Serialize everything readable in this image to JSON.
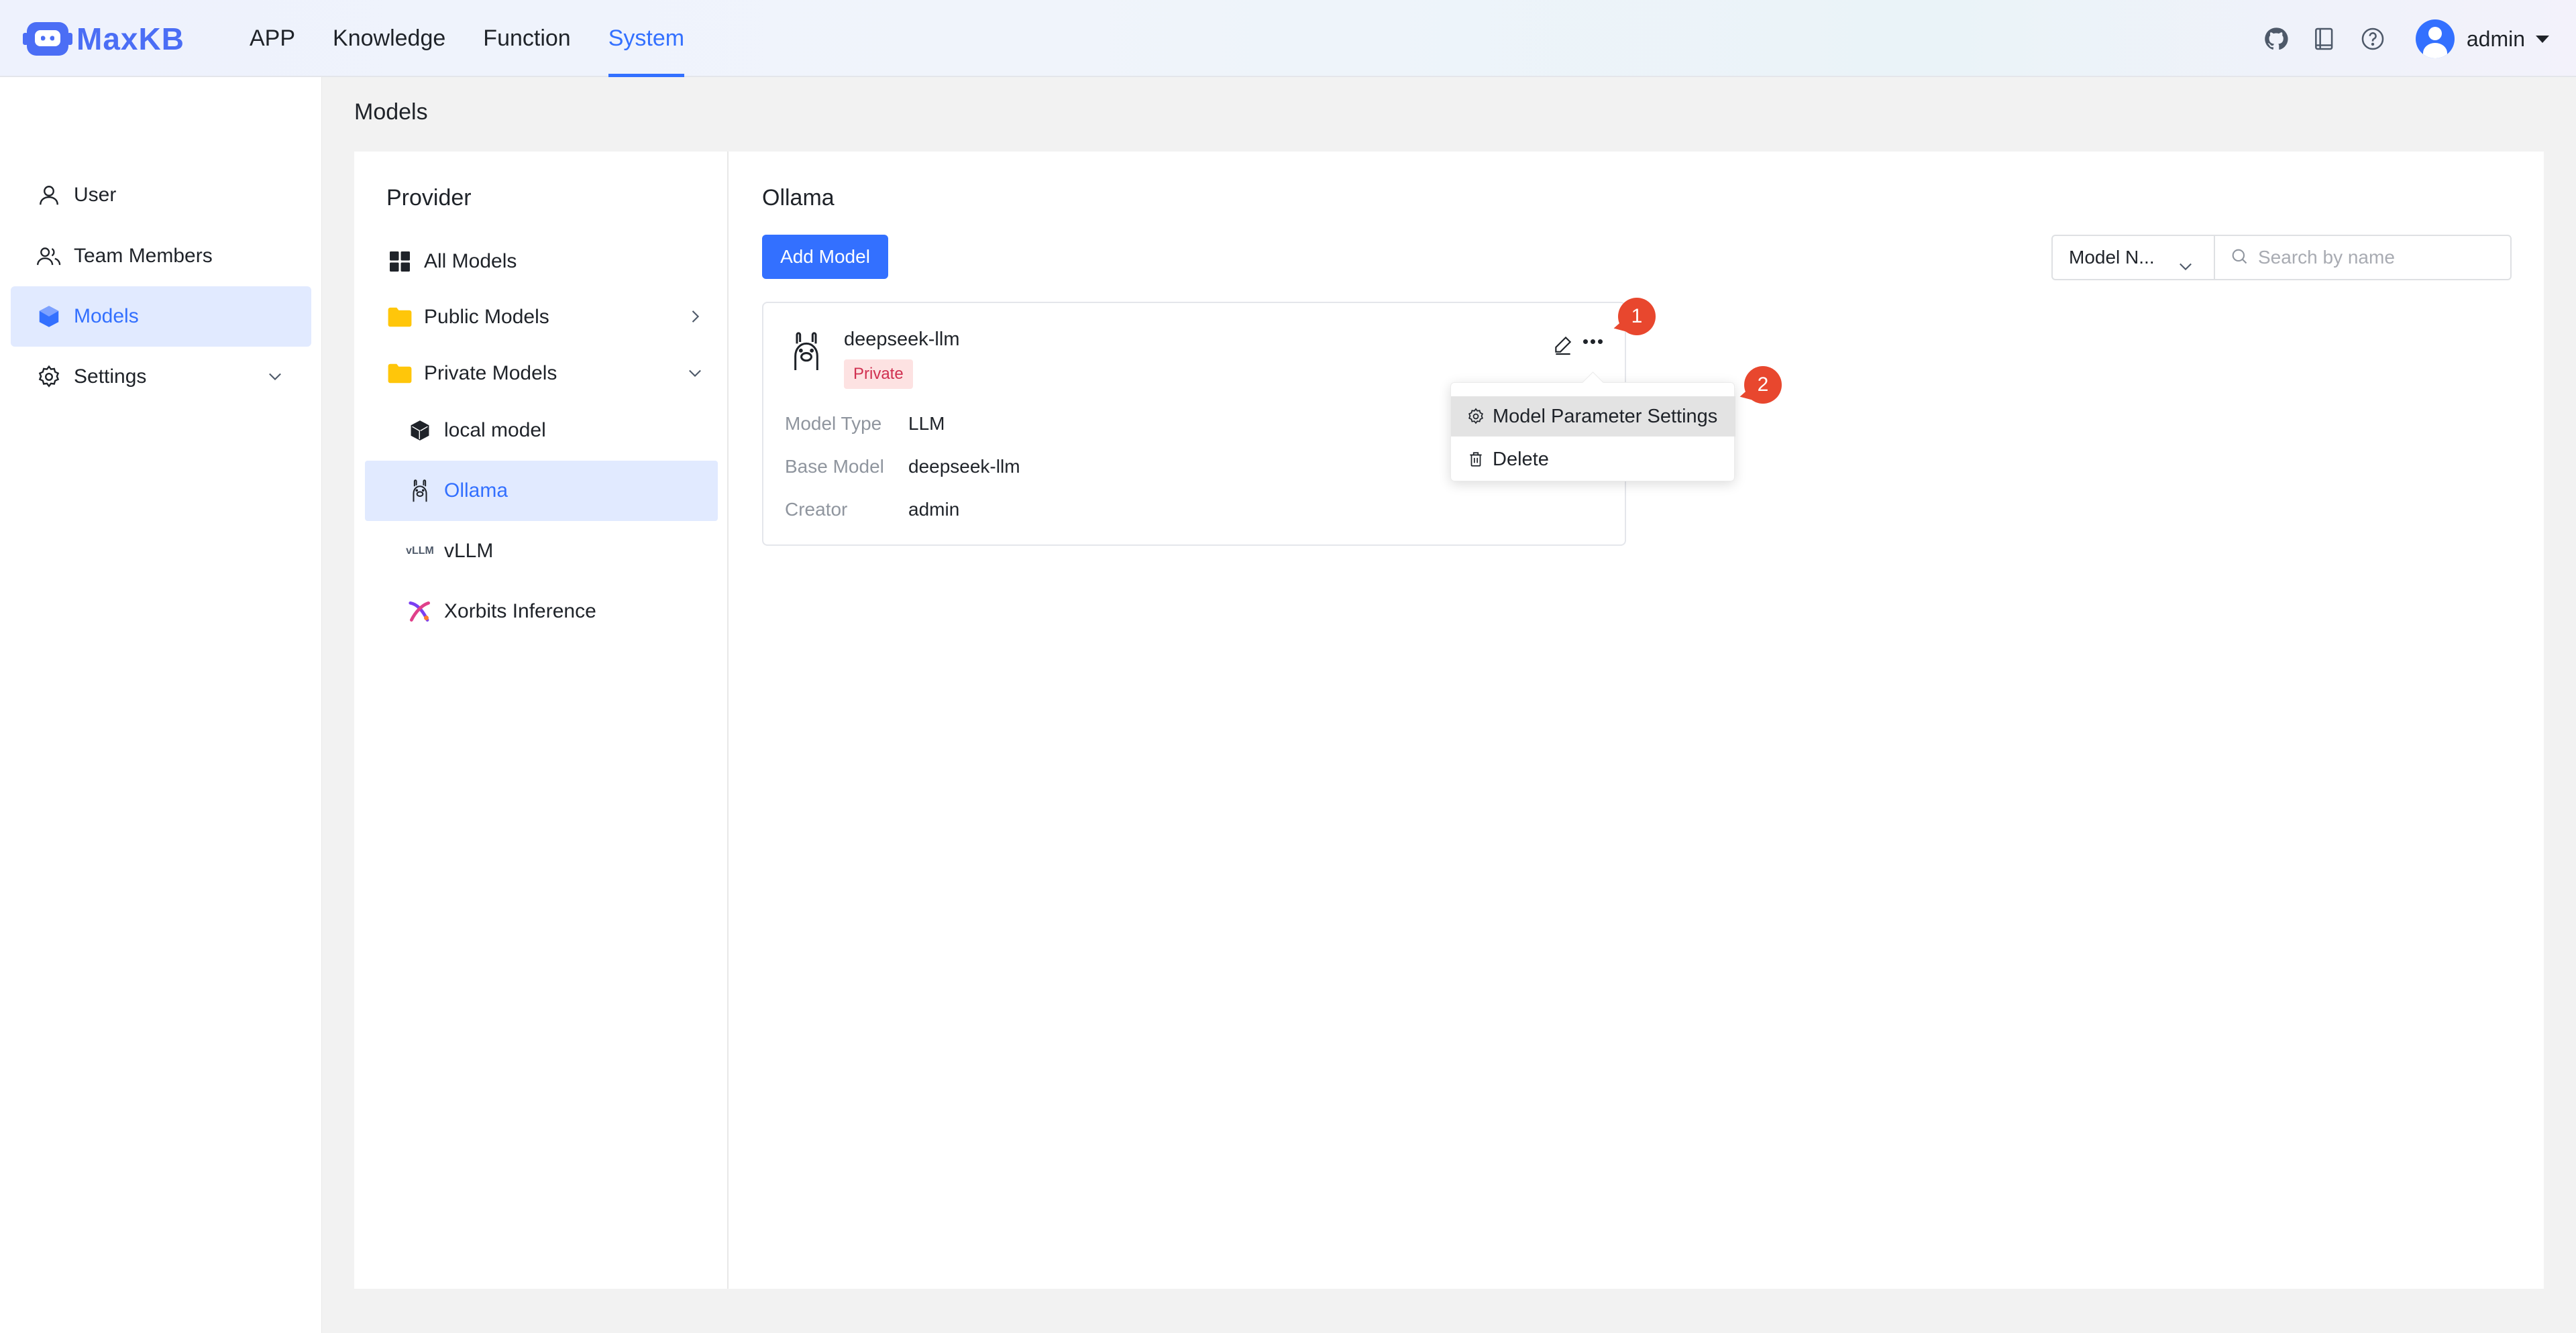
{
  "app": {
    "name": "MaxKB"
  },
  "topnav": [
    {
      "label": "APP",
      "active": false
    },
    {
      "label": "Knowledge",
      "active": false
    },
    {
      "label": "Function",
      "active": false
    },
    {
      "label": "System",
      "active": true
    }
  ],
  "user": {
    "name": "admin"
  },
  "sidebar": {
    "items": [
      {
        "label": "User",
        "icon": "user-icon"
      },
      {
        "label": "Team Members",
        "icon": "team-icon"
      },
      {
        "label": "Models",
        "icon": "cube-icon",
        "active": true
      },
      {
        "label": "Settings",
        "icon": "gear-icon"
      }
    ]
  },
  "page": {
    "title": "Models"
  },
  "provider": {
    "title": "Provider",
    "items": [
      {
        "label": "All Models",
        "icon": "grid-icon"
      },
      {
        "label": "Public Models",
        "icon": "folder-icon"
      },
      {
        "label": "Private Models",
        "icon": "folder-icon"
      },
      {
        "label": "local model",
        "icon": "cube-icon"
      },
      {
        "label": "Ollama",
        "icon": "llama-icon",
        "active": true
      },
      {
        "label": "vLLM",
        "icon": "vllm-icon",
        "icon_text": "vLLM"
      },
      {
        "label": "Xorbits Inference",
        "icon": "xorbits-icon"
      }
    ]
  },
  "content": {
    "title": "Ollama",
    "add_button": "Add Model",
    "filter_select": "Model N...",
    "search_placeholder": "Search by name"
  },
  "card": {
    "name": "deepseek-llm",
    "badge": "Private",
    "rows": [
      {
        "key": "Model Type",
        "value": "LLM"
      },
      {
        "key": "Base Model",
        "value": "deepseek-llm"
      },
      {
        "key": "Creator",
        "value": "admin"
      }
    ]
  },
  "menu": {
    "items": [
      {
        "label": "Model Parameter Settings",
        "icon": "gear-icon"
      },
      {
        "label": "Delete",
        "icon": "trash-icon"
      }
    ]
  },
  "markers": [
    "1",
    "2"
  ],
  "colors": {
    "accent": "#3370ff",
    "marker": "#e8472e",
    "badge_text": "#d03050",
    "badge_bg": "#fde2e2"
  }
}
